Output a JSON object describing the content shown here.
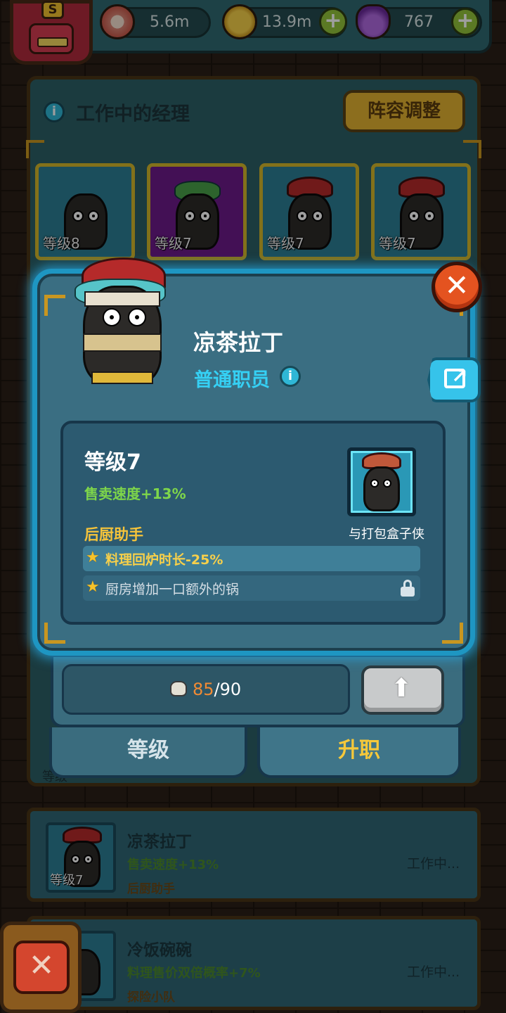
{
  "topbar": {
    "eyes_value": "5.6m",
    "coins_value": "13.9m",
    "potions_value": "767",
    "avatar_badge": "S",
    "plus_label": "+"
  },
  "managers_panel": {
    "title": "工作中的经理",
    "info_label": "i",
    "lineup_button": "阵容调整",
    "slots": [
      {
        "level": "等级8"
      },
      {
        "level": "等级7"
      },
      {
        "level": "等级7"
      },
      {
        "level": "等级7"
      }
    ]
  },
  "modal": {
    "close_label": "✕",
    "name": "凉茶拉丁",
    "role": "普通职员",
    "info_label": "i",
    "level_title": "等级7",
    "effect": "售卖速度+13%",
    "skill_section": "后厨助手",
    "partner_label": "与打包盒子侠",
    "skills": [
      {
        "text": "料理回炉时长-25%",
        "state": "active"
      },
      {
        "text": "厨房增加一口额外的锅",
        "state": "locked"
      }
    ],
    "progress": {
      "current": "85",
      "separator": "/",
      "max": "90"
    },
    "upgrade_arrow": "⬆",
    "tabs": {
      "level": "等级",
      "promote": "升职"
    }
  },
  "list": [
    {
      "name": "凉茶拉丁",
      "effect": "售卖速度+13%",
      "skill": "后厨助手",
      "status": "工作中...",
      "level": "等级7"
    },
    {
      "name": "冷饭碗碗",
      "effect": "料理售价双倍概率+7%",
      "skill": "探险小队",
      "status": "工作中...",
      "level": ""
    }
  ],
  "hidden_level_label": "等级",
  "bottom_close_label": "✕",
  "colors": {
    "accent_blue": "#1e96c2",
    "gold": "#f5c33a",
    "green": "#7ed64a",
    "orange": "#f08a34"
  }
}
